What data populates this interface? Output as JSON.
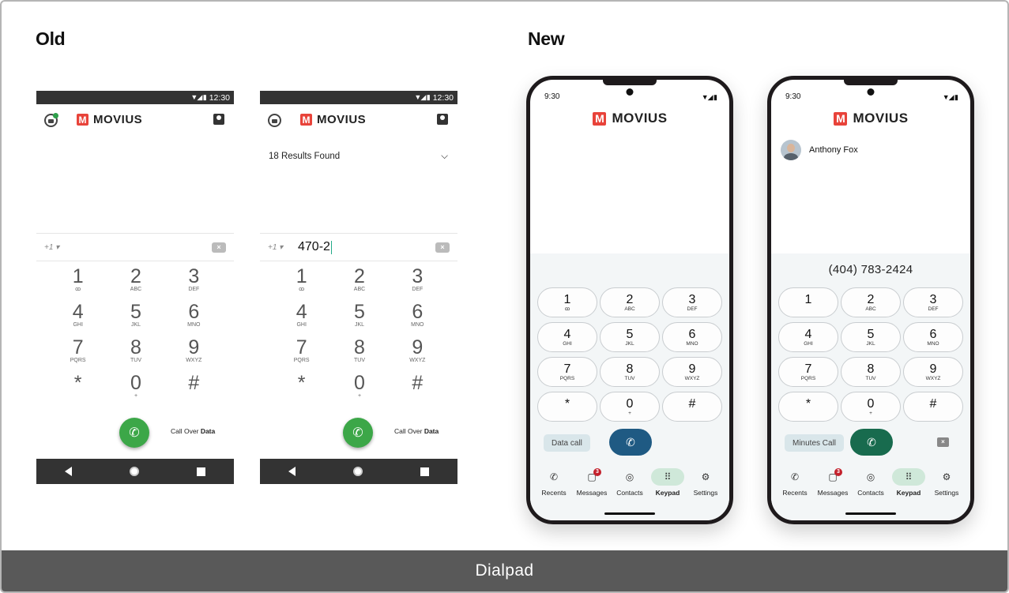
{
  "headings": {
    "old": "Old",
    "new": "New"
  },
  "footer": "Dialpad",
  "brand": {
    "logo_letter": "M",
    "name": "MOVIUS"
  },
  "old_phone": {
    "status_time": "12:30",
    "status_icons": "▼◢ ▮",
    "country_code": "+1 ▾",
    "backspace": "×",
    "keys": [
      {
        "digit": "1",
        "letters": "ꝏ"
      },
      {
        "digit": "2",
        "letters": "ABC"
      },
      {
        "digit": "3",
        "letters": "DEF"
      },
      {
        "digit": "4",
        "letters": "GHI"
      },
      {
        "digit": "5",
        "letters": "JKL"
      },
      {
        "digit": "6",
        "letters": "MNO"
      },
      {
        "digit": "7",
        "letters": "PQRS"
      },
      {
        "digit": "8",
        "letters": "TUV"
      },
      {
        "digit": "9",
        "letters": "WXYZ"
      },
      {
        "digit": "*",
        "letters": ""
      },
      {
        "digit": "0",
        "letters": "+"
      },
      {
        "digit": "#",
        "letters": ""
      }
    ],
    "call_icon": "✆",
    "call_over_prefix": "Call Over",
    "call_over_bold": "Data",
    "search_results": "18 Results Found",
    "results_chevron": "⌵",
    "typed_number": "470-2"
  },
  "new_phone": {
    "status_time": "9:30",
    "status_icons": "▼◢ ▮",
    "keys": [
      {
        "digit": "1",
        "letters": "ꝏ"
      },
      {
        "digit": "2",
        "letters": "ABC"
      },
      {
        "digit": "3",
        "letters": "DEF"
      },
      {
        "digit": "4",
        "letters": "GHI"
      },
      {
        "digit": "5",
        "letters": "JKL"
      },
      {
        "digit": "6",
        "letters": "MNO"
      },
      {
        "digit": "7",
        "letters": "PQRS"
      },
      {
        "digit": "8",
        "letters": "TUV"
      },
      {
        "digit": "9",
        "letters": "WXYZ"
      },
      {
        "digit": "*",
        "letters": ""
      },
      {
        "digit": "0",
        "letters": "+"
      },
      {
        "digit": "#",
        "letters": ""
      }
    ],
    "keys2": [
      {
        "digit": "1",
        "letters": ""
      },
      {
        "digit": "2",
        "letters": "ABC"
      },
      {
        "digit": "3",
        "letters": "DEF"
      },
      {
        "digit": "4",
        "letters": "GHI"
      },
      {
        "digit": "5",
        "letters": "JKL"
      },
      {
        "digit": "6",
        "letters": "MNO"
      },
      {
        "digit": "7",
        "letters": "PQRS"
      },
      {
        "digit": "8",
        "letters": "TUV"
      },
      {
        "digit": "9",
        "letters": "WXYZ"
      },
      {
        "digit": "*",
        "letters": ""
      },
      {
        "digit": "0",
        "letters": "+"
      },
      {
        "digit": "#",
        "letters": ""
      }
    ],
    "data_call_label": "Data call",
    "minutes_call_label": "Minutes Call",
    "call_icon": "✆",
    "backspace": "×",
    "contact_name": "Anthony Fox",
    "dialed_number": "(404) 783-2424",
    "tabs": [
      {
        "label": "Recents",
        "icon": "✆"
      },
      {
        "label": "Messages",
        "icon": "▢",
        "badge": "3"
      },
      {
        "label": "Contacts",
        "icon": "◎"
      },
      {
        "label": "Keypad",
        "icon": "⠿"
      },
      {
        "label": "Settings",
        "icon": "⚙"
      }
    ]
  },
  "colors": {
    "brand": "#e8433a",
    "call_green_old": "#3ca748",
    "call_blue": "#1f5a83",
    "call_green_new": "#186b4e",
    "badge": "#c3202b"
  }
}
